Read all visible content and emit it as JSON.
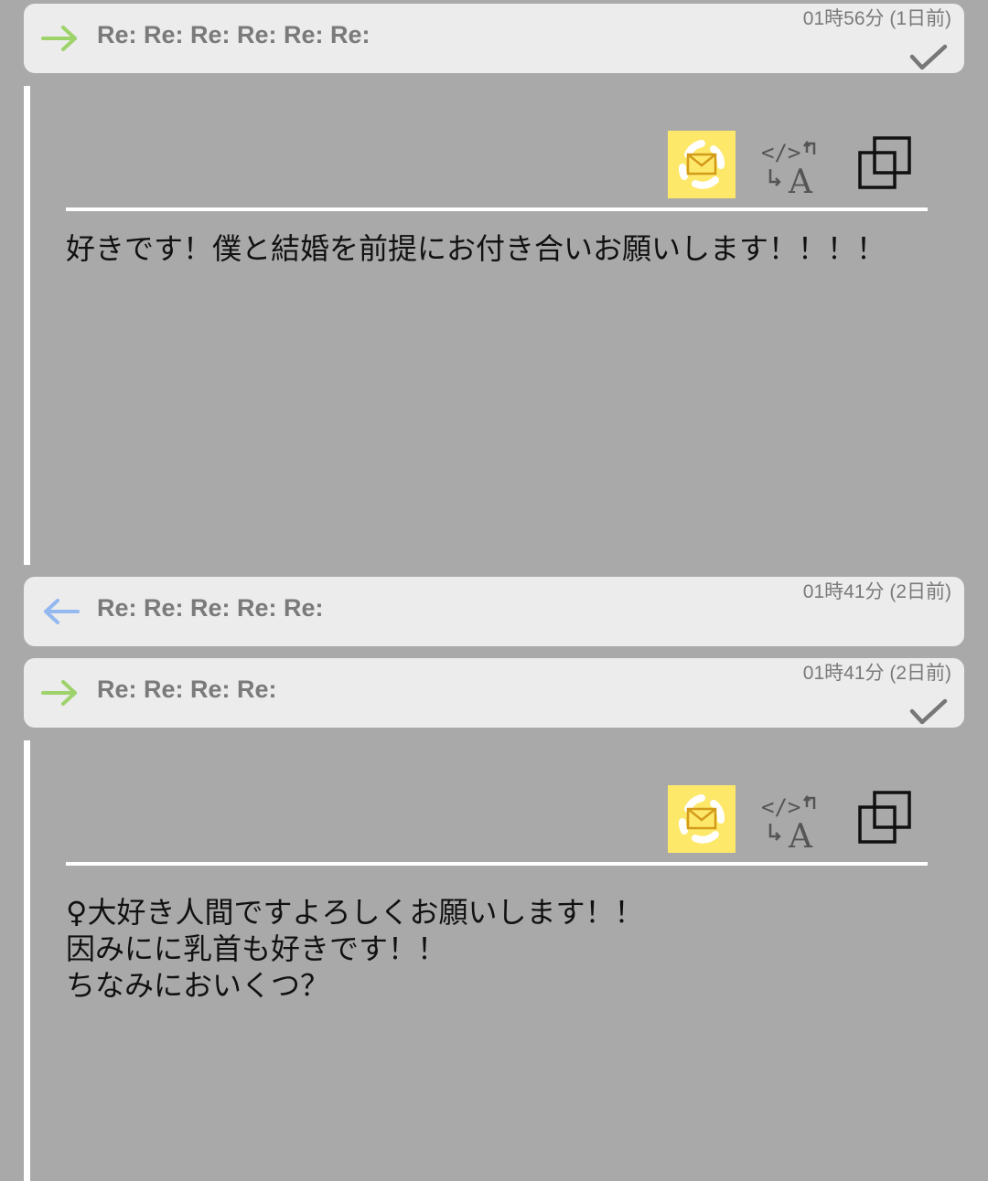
{
  "threads": [
    {
      "direction": "sent",
      "subject": "Re: Re: Re: Re: Re: Re:",
      "timestamp": "01時56分 (1日前)",
      "read": true,
      "message_lines": [
        "好きです！僕と結婚を前提にお付き合いお願いします！！！！"
      ]
    },
    {
      "direction": "received",
      "subject": "Re: Re: Re: Re: Re:",
      "timestamp": "01時41分 (2日前)",
      "read": false
    },
    {
      "direction": "sent",
      "subject": "Re: Re: Re: Re:",
      "timestamp": "01時41分 (2日前)",
      "read": true,
      "message_lines": [
        "♀大好き人間ですよろしくお願いします！！",
        "因みにに乳首も好きです！！",
        "ちなみにおいくつ？"
      ]
    }
  ],
  "icons": {
    "sent": "arrow-right-icon",
    "received": "arrow-left-icon",
    "read": "checkmark-icon",
    "save_mail": "recycle-mail-icon",
    "translate": "translate-icon",
    "copy": "copy-icon"
  },
  "colors": {
    "background": "#a9a9a9",
    "header_bg": "#ececec",
    "sent_arrow": "#9ed26a",
    "received_arrow": "#93b9f0",
    "mail_button_bg": "#fde86a",
    "divider": "#ffffff",
    "muted_text": "#7a7a7a"
  }
}
